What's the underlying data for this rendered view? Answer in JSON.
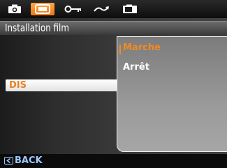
{
  "top_tabs": [
    {
      "icon": "camera-icon",
      "active": false
    },
    {
      "icon": "display-frame-icon",
      "active": true
    },
    {
      "icon": "key-settings-icon",
      "active": false
    },
    {
      "icon": "transfer-wave-icon",
      "active": false
    },
    {
      "icon": "playback-screen-icon",
      "active": false
    }
  ],
  "header": {
    "title": "Installation film"
  },
  "menu": {
    "item_label": "DIS"
  },
  "options": {
    "selected": "Marche",
    "other": "Arrêt"
  },
  "footer": {
    "back_label": "BACK"
  },
  "colors": {
    "accent": "#f28a1e",
    "back": "#9ec8ff"
  }
}
